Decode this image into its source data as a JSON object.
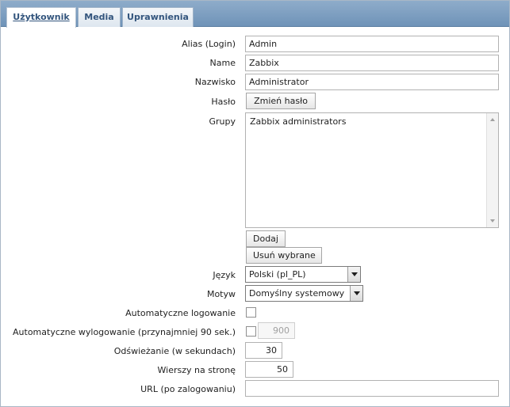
{
  "tabs": [
    {
      "label": "Użytkownik",
      "active": true
    },
    {
      "label": "Media",
      "active": false
    },
    {
      "label": "Uprawnienia",
      "active": false
    }
  ],
  "form": {
    "alias": {
      "label": "Alias (Login)",
      "value": "Admin"
    },
    "name": {
      "label": "Name",
      "value": "Zabbix"
    },
    "surname": {
      "label": "Nazwisko",
      "value": "Administrator"
    },
    "password": {
      "label": "Hasło",
      "button": "Zmień hasło"
    },
    "groups": {
      "label": "Grupy",
      "items": [
        "Zabbix administrators"
      ],
      "add_button": "Dodaj",
      "remove_button": "Usuń wybrane"
    },
    "language": {
      "label": "Język",
      "value": "Polski (pl_PL)"
    },
    "theme": {
      "label": "Motyw",
      "value": "Domyślny systemowy"
    },
    "autologin": {
      "label": "Automatyczne logowanie",
      "checked": false
    },
    "autologout": {
      "label": "Automatyczne wylogowanie (przynajmniej 90 sek.)",
      "checked": false,
      "value": "900"
    },
    "refresh": {
      "label": "Odświeżanie (w sekundach)",
      "value": "30"
    },
    "rows": {
      "label": "Wierszy na stronę",
      "value": "50"
    },
    "url": {
      "label": "URL (po zalogowaniu)",
      "value": ""
    }
  }
}
